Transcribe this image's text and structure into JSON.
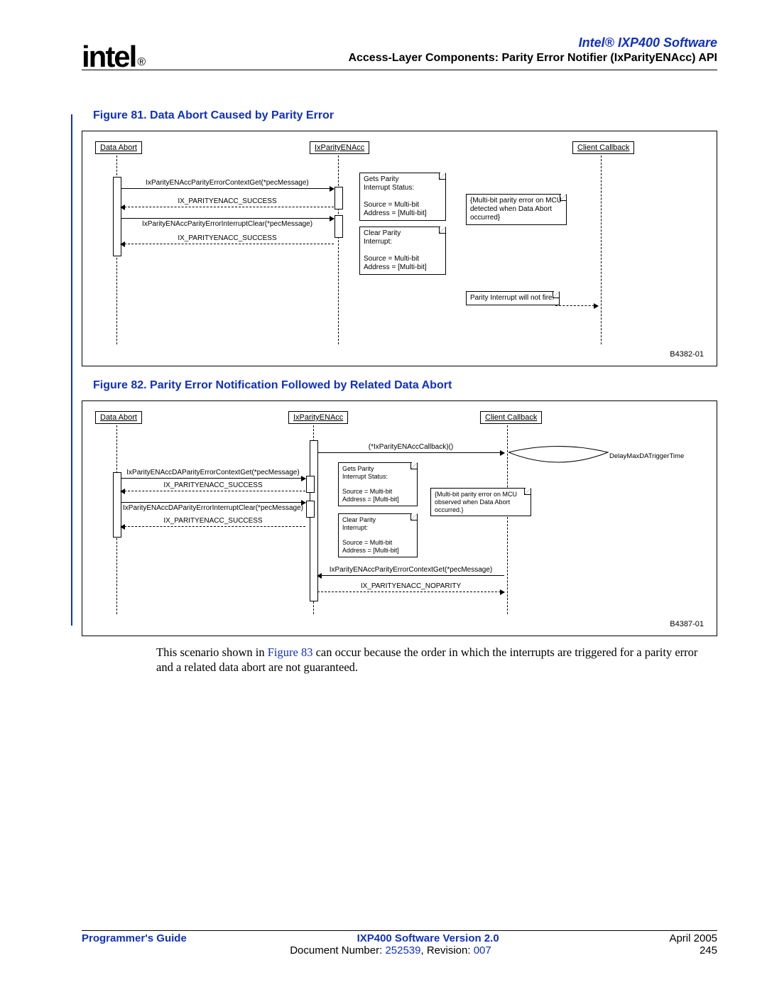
{
  "header": {
    "logo_text": "intel",
    "logo_mark": "®",
    "product": "Intel® IXP400 Software",
    "subtitle": "Access-Layer Components: Parity Error Notifier (IxParityENAcc) API"
  },
  "figure81": {
    "caption": "Figure 81. Data Abort Caused by Parity Error",
    "id": "B4382-01",
    "heads": {
      "a": "Data Abort",
      "b": "IxParityENAcc",
      "c": "Client Callback"
    },
    "msgs": {
      "m1": "IxParityENAccParityErrorContextGet(*pecMessage)",
      "m2": "IX_PARITYENACC_SUCCESS",
      "m3": "IxParityENAccParityErrorInterruptClear(*pecMessage)",
      "m4": "IX_PARITYENACC_SUCCESS"
    },
    "note1": "Gets Parity\nInterrupt Status:\n\nSource = Multi-bit\nAddress = [Multi-bit]",
    "note2": "{Multi-bit parity error on MCU detected when Data Abort occurred}",
    "note3": "Clear Parity\nInterrupt:\n\nSource = Multi-bit\nAddress = [Multi-bit]",
    "note4": "Parity Interrupt will not fire."
  },
  "figure82": {
    "caption": "Figure 82. Parity Error Notification Followed by Related Data Abort",
    "id": "B4387-01",
    "heads": {
      "a": "Data Abort",
      "b": "IxParityENAcc",
      "c": "Client Callback"
    },
    "callback": "(*IxParityENAccCallback)()",
    "delay": "DelayMaxDATriggerTime",
    "msgs": {
      "m1": "IxParityENAccDAParityErrorContextGet(*pecMessage)",
      "m2": "IX_PARITYENACC_SUCCESS",
      "m3": "IxParityENAccDAParityErrorInterruptClear(*pecMessage)",
      "m4": "IX_PARITYENACC_SUCCESS",
      "m5": "IxParityENAccParityErrorContextGet(*pecMessage)",
      "m6": "IX_PARITYENACC_NOPARITY"
    },
    "note1": "Gets Parity\nInterrupt Status:\n\nSource = Multi-bit\nAddress = [Multi-bit]",
    "note2": "{Multi-bit parity error on MCU observed when Data Abort occurred.}",
    "note3": "Clear Parity\nInterrupt:\n\nSource = Multi-bit\nAddress = [Multi-bit]"
  },
  "body": {
    "pre": "This scenario shown in ",
    "figref": "Figure 83",
    "post": " can occur because the order in which the interrupts are triggered for a parity error and a related data abort are not guaranteed."
  },
  "footer": {
    "left1": "Programmer's Guide",
    "center1": "IXP400 Software Version 2.0",
    "right1": "April 2005",
    "center2a": "Document Number: ",
    "center2b": "252539",
    "center2c": ", Revision: ",
    "center2d": "007",
    "right2": "245"
  }
}
